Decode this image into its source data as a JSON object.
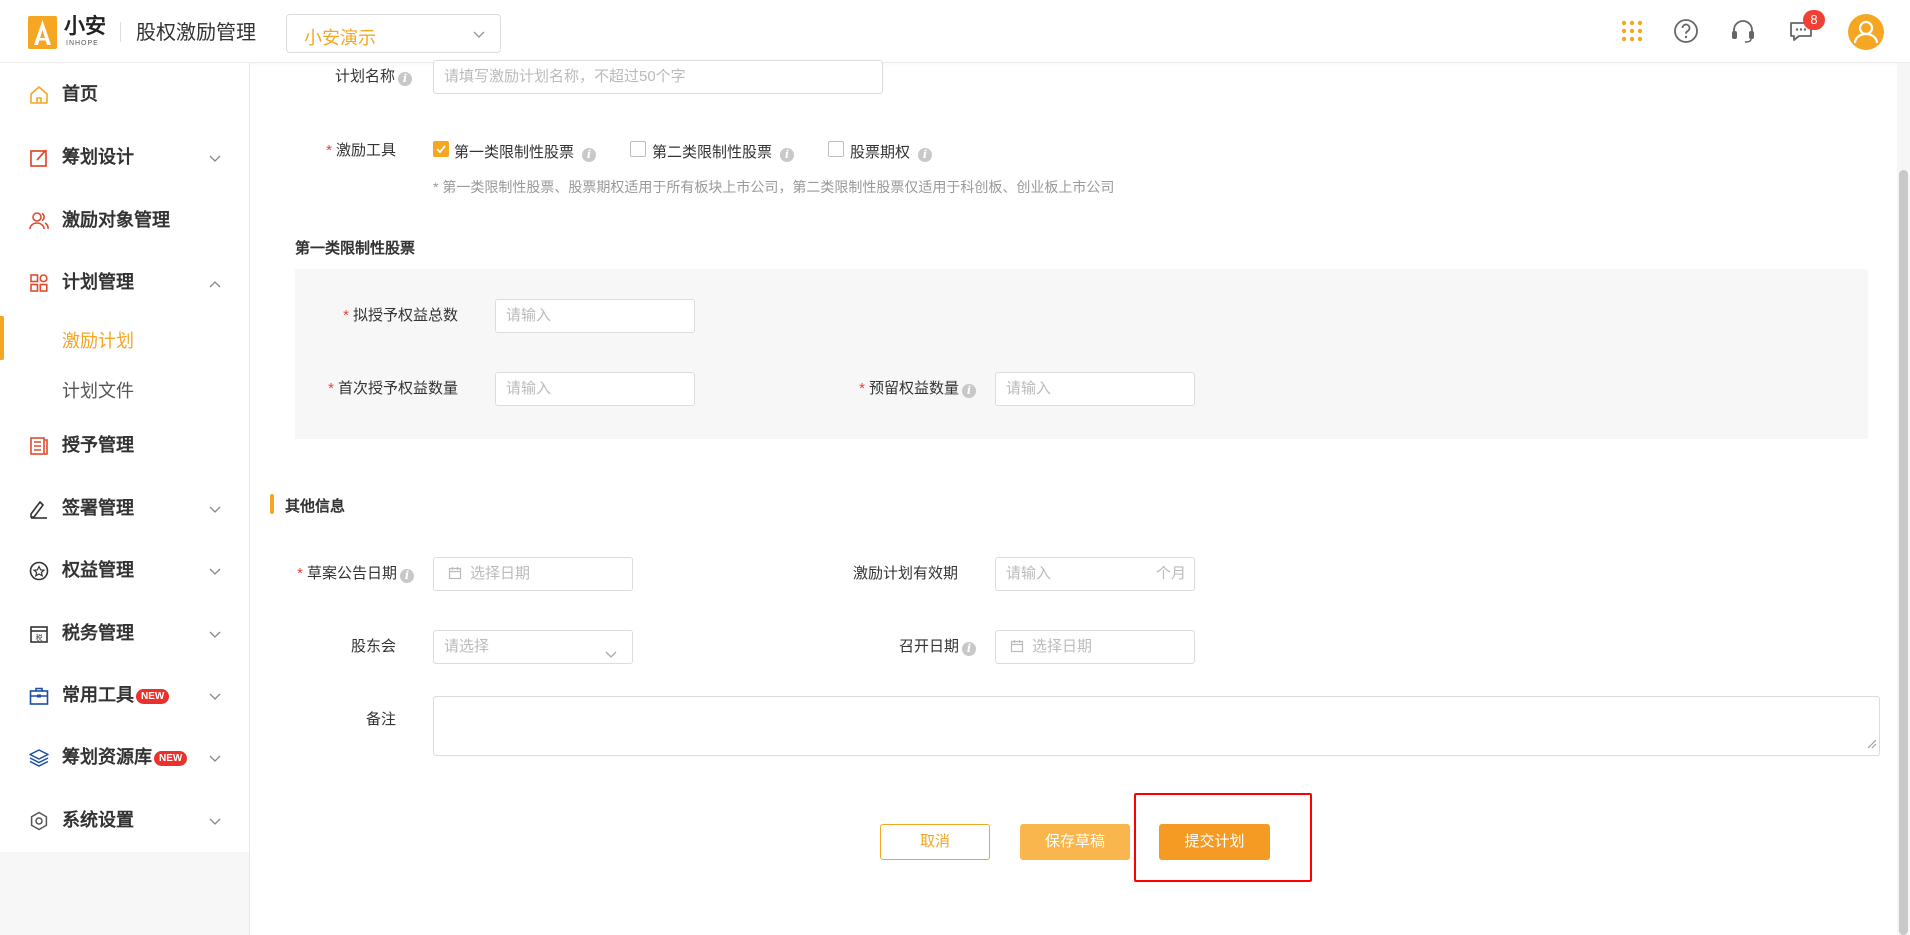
{
  "header": {
    "logo_text": "小安",
    "logo_sub": "INHOPE",
    "app_title": "股权激励管理",
    "company": "小安演示",
    "notification_count": "8"
  },
  "sidebar": {
    "items": [
      {
        "label": "首页",
        "icon": "home-icon"
      },
      {
        "label": "筹划设计",
        "icon": "edit-icon"
      },
      {
        "label": "激励对象管理",
        "icon": "users-icon"
      },
      {
        "label": "计划管理",
        "icon": "grid-icon"
      },
      {
        "label": "激励计划"
      },
      {
        "label": "计划文件"
      },
      {
        "label": "授予管理",
        "icon": "book-icon"
      },
      {
        "label": "签署管理",
        "icon": "sign-icon"
      },
      {
        "label": "权益管理",
        "icon": "badge-icon"
      },
      {
        "label": "税务管理",
        "icon": "tax-icon"
      },
      {
        "label": "常用工具",
        "icon": "toolbox-icon",
        "tag": "NEW"
      },
      {
        "label": "筹划资源库",
        "icon": "layers-icon",
        "tag": "NEW"
      },
      {
        "label": "系统设置",
        "icon": "settings-icon"
      }
    ]
  },
  "form": {
    "plan_name": {
      "label": "计划名称",
      "placeholder": "请填写激励计划名称，不超过50个字"
    },
    "tool": {
      "label": "激励工具",
      "options": [
        {
          "label": "第一类限制性股票",
          "checked": true
        },
        {
          "label": "第二类限制性股票",
          "checked": false
        },
        {
          "label": "股票期权",
          "checked": false
        }
      ],
      "hint": "* 第一类限制性股票、股票期权适用于所有板块上市公司，第二类限制性股票仅适用于科创板、创业板上市公司"
    },
    "section1": {
      "title": "第一类限制性股票",
      "total": {
        "label": "拟授予权益总数",
        "placeholder": "请输入"
      },
      "first": {
        "label": "首次授予权益数量",
        "placeholder": "请输入"
      },
      "reserved": {
        "label": "预留权益数量",
        "placeholder": "请输入"
      }
    },
    "section2": {
      "title": "其他信息",
      "draft_date": {
        "label": "草案公告日期",
        "placeholder": "选择日期"
      },
      "validity": {
        "label": "激励计划有效期",
        "placeholder": "请输入",
        "suffix": "个月"
      },
      "meeting": {
        "label": "股东会",
        "placeholder": "请选择"
      },
      "meeting_date": {
        "label": "召开日期",
        "placeholder": "选择日期"
      },
      "remark": {
        "label": "备注"
      }
    }
  },
  "actions": {
    "cancel": "取消",
    "save_draft": "保存草稿",
    "submit": "提交计划"
  },
  "colors": {
    "accent": "#f5a623",
    "danger": "#f04134"
  }
}
